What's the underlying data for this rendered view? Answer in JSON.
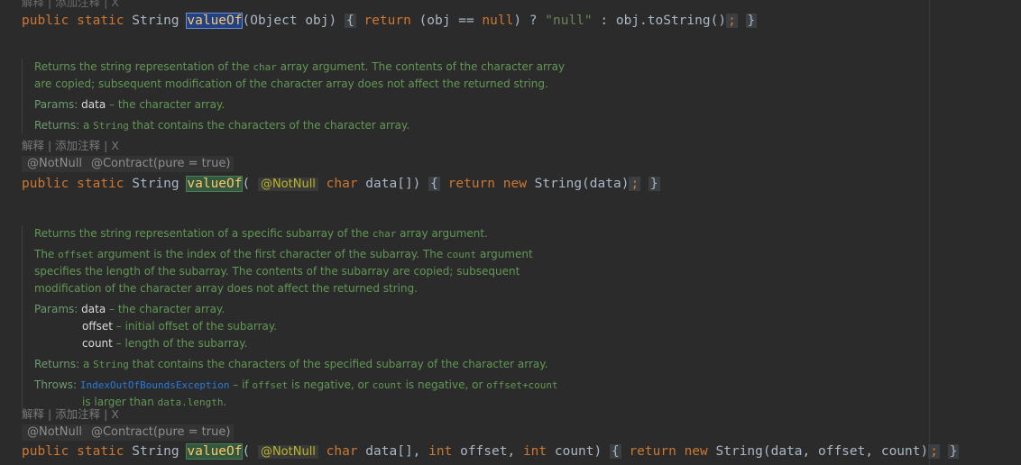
{
  "hint_label": "解释 | 添加注释 | X",
  "line1": {
    "public": "public",
    "static": "static",
    "type": "String",
    "method": "valueOf",
    "params": "(Object obj)",
    "open": "{",
    "return": "return",
    "cond_open": " (obj == ",
    "null_kw": "null",
    "cond_close": ") ? ",
    "null_str": "\"null\"",
    "tail": " : obj.toString()",
    "semi": ";",
    "close": "}"
  },
  "doc1": {
    "l1a": "Returns the string representation of the ",
    "l1code": "char",
    "l1b": " array argument. The contents of the character array",
    "l2": "are copied; subsequent modification of the character array does not affect the returned string.",
    "params_label": "Params:",
    "param_name": "data",
    "param_desc": " – the character array.",
    "returns_label": "Returns:",
    "returns_a": " a ",
    "returns_code": "String",
    "returns_b": " that contains the characters of the character array."
  },
  "ann1": {
    "notnull": "@NotNull",
    "contract": "@Contract(pure = true)"
  },
  "line2": {
    "public": "public",
    "static": "static",
    "type": "String",
    "method": "valueOf",
    "paren": "(",
    "notnull": "@NotNull",
    "char_kw": "char",
    "param": " data[])",
    "open": "{",
    "return": "return",
    "new_kw": "new",
    "tail": " String(data)",
    "semi": ";",
    "close": "}"
  },
  "doc2": {
    "l1a": "Returns the string representation of a specific subarray of the ",
    "l1code": "char",
    "l1b": " array argument.",
    "p2a": "The ",
    "p2code1": "offset",
    "p2b": " argument is the index of the first character of the subarray. The ",
    "p2code2": "count",
    "p2c": " argument",
    "p2l2": "specifies the length of the subarray. The contents of the subarray are copied; subsequent",
    "p2l3": "modification of the character array does not affect the returned string.",
    "params_label": "Params:",
    "param1_name": "data",
    "param1_desc": " – the character array.",
    "param2_name": "offset",
    "param2_desc": " – initial offset of the subarray.",
    "param3_name": "count",
    "param3_desc": " – length of the subarray.",
    "returns_label": "Returns:",
    "returns_a": " a ",
    "returns_code": "String",
    "returns_b": " that contains the characters of the specified subarray of the character array.",
    "throws_label": "Throws:",
    "throws_exc": "IndexOutOfBoundsException",
    "throws_a": " – if ",
    "throws_code1": "offset",
    "throws_b": " is negative, or ",
    "throws_code2": "count",
    "throws_c": " is negative, or ",
    "throws_code3": "offset+count",
    "throws_l2a": "is larger than ",
    "throws_code4": "data.length",
    "throws_l2b": "."
  },
  "ann2": {
    "notnull": "@NotNull",
    "contract": "@Contract(pure = true)"
  },
  "line3": {
    "public": "public",
    "static": "static",
    "type": "String",
    "method": "valueOf",
    "paren": "(",
    "notnull": "@NotNull",
    "char_kw": "char",
    "p1": " data[], ",
    "int1": "int",
    "p2": " offset, ",
    "int2": "int",
    "p3": " count)",
    "open": "{",
    "return": "return",
    "new_kw": "new",
    "tail": " String(data, offset, count)",
    "semi": ";",
    "close": "}"
  }
}
